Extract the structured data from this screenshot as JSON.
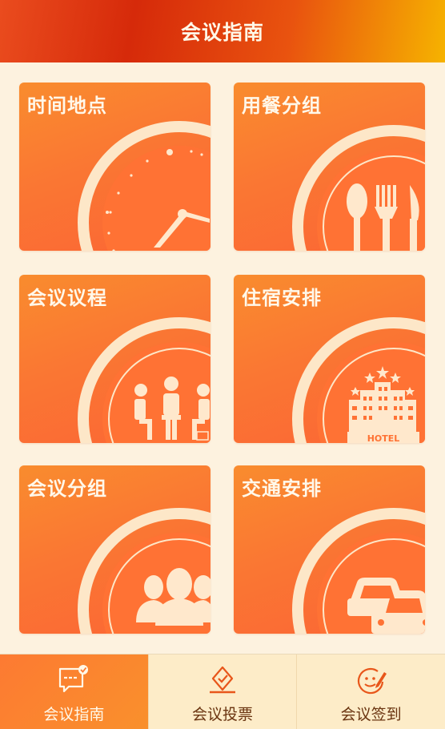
{
  "header": {
    "title": "会议指南"
  },
  "tiles": [
    {
      "label": "时间地点",
      "icon": "clock-icon"
    },
    {
      "label": "用餐分组",
      "icon": "cutlery-icon"
    },
    {
      "label": "会议议程",
      "icon": "meeting-icon"
    },
    {
      "label": "住宿安排",
      "icon": "hotel-icon",
      "sign": "HOTEL"
    },
    {
      "label": "会议分组",
      "icon": "group-icon"
    },
    {
      "label": "交通安排",
      "icon": "car-icon"
    }
  ],
  "tabs": [
    {
      "label": "会议指南",
      "icon": "guide-chat-icon",
      "active": true
    },
    {
      "label": "会议投票",
      "icon": "vote-icon",
      "active": false
    },
    {
      "label": "会议签到",
      "icon": "signin-icon",
      "active": false
    }
  ],
  "colors": {
    "header": "#d62a0a",
    "tile": "#fa7733",
    "cream": "#fdf2df",
    "tab_active": "#fd7a32"
  }
}
